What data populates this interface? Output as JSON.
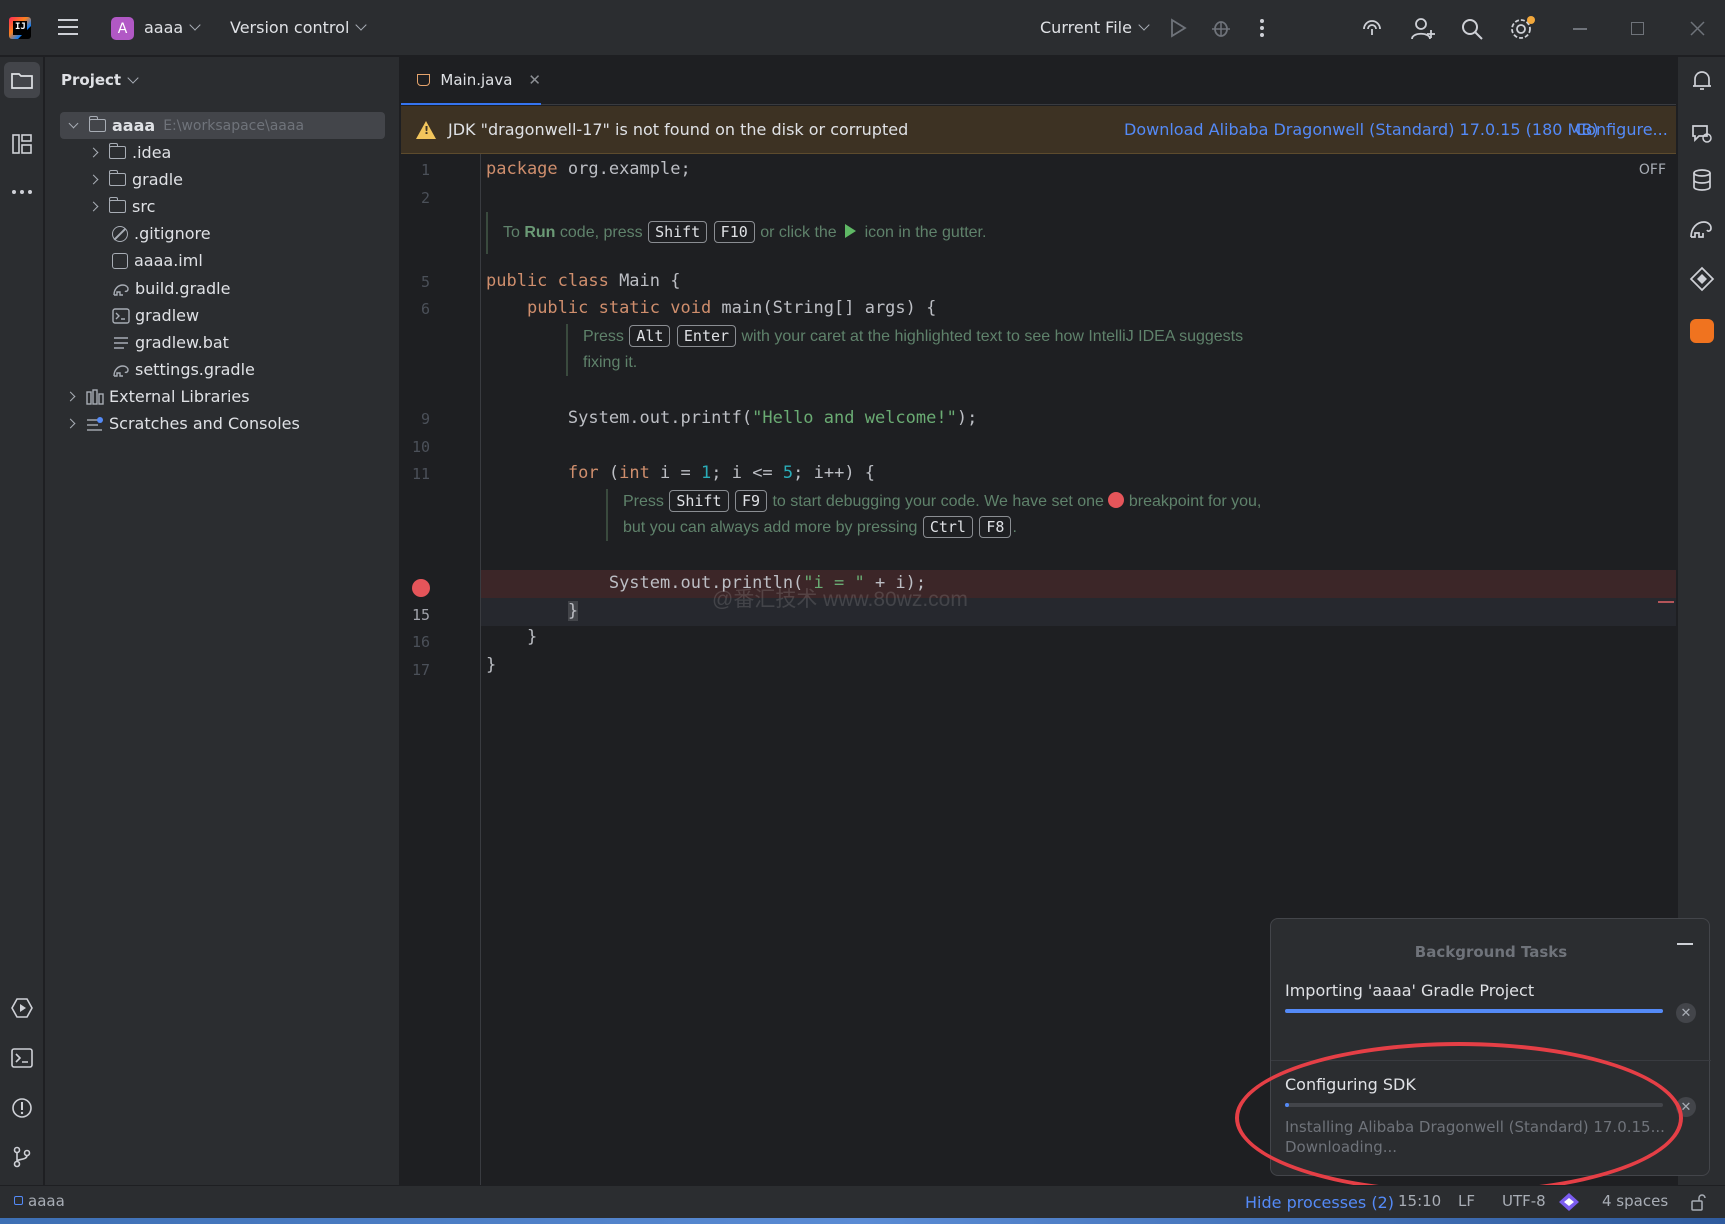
{
  "titlebar": {
    "logo_text": "IJ",
    "project_initial": "A",
    "project_name": "aaaa",
    "vcs_label": "Version control",
    "run_config": "Current File"
  },
  "project_panel": {
    "title": "Project",
    "root_name": "aaaa",
    "root_path": "E:\\worksapace\\aaaa",
    "items": [
      {
        "label": ".idea",
        "icon": "folder-icon"
      },
      {
        "label": "gradle",
        "icon": "folder-icon"
      },
      {
        "label": "src",
        "icon": "folder-icon"
      },
      {
        "label": ".gitignore",
        "icon": "ignore-file-icon"
      },
      {
        "label": "aaaa.iml",
        "icon": "module-file-icon"
      },
      {
        "label": "build.gradle",
        "icon": "gradle-file-icon"
      },
      {
        "label": "gradlew",
        "icon": "script-file-icon"
      },
      {
        "label": "gradlew.bat",
        "icon": "text-file-icon"
      },
      {
        "label": "settings.gradle",
        "icon": "gradle-file-icon"
      }
    ],
    "external_libraries": "External Libraries",
    "scratches": "Scratches and Consoles"
  },
  "editor": {
    "tab_label": "Main.java",
    "jdk_warning": "JDK \"dragonwell-17\" is not found on the disk or corrupted",
    "download_link": "Download Alibaba Dragonwell (Standard) 17.0.15 (180 MB)",
    "configure_link": "Configure...",
    "off_label": "OFF",
    "line_numbers": [
      "1",
      "2",
      "5",
      "6",
      "9",
      "10",
      "11",
      "15",
      "16",
      "17"
    ],
    "code": {
      "l1_kw": "package",
      "l1_rest": " org.example;",
      "l5_kw": "public class",
      "l5_rest": " Main {",
      "l6_kw": "public static void",
      "l6_rest": " main(String[] args) {",
      "l9_a": "System.out.printf(",
      "l9_str": "\"Hello and welcome!\"",
      "l9_b": ");",
      "l11_kw1": "for",
      "l11_a": " (",
      "l11_kw2": "int",
      "l11_b": " i = ",
      "l11_n1": "1",
      "l11_c": "; i <= ",
      "l11_n2": "5",
      "l11_d": "; i++) {",
      "l14_a": "System.out.println(",
      "l14_str": "\"i = \"",
      "l14_b": " + i);",
      "l15": "}",
      "l16": "}",
      "l17": "}"
    },
    "hint1": {
      "a": "To ",
      "b": "Run",
      "c": " code, press ",
      "k1": "Shift",
      "k2": "F10",
      "d": " or click the ",
      "e": " icon in the gutter."
    },
    "hint2": {
      "a": "Press ",
      "k1": "Alt",
      "k2": "Enter",
      "b": " with your caret at the highlighted text to see how IntelliJ IDEA suggests",
      "c": "fixing it."
    },
    "hint3": {
      "a": "Press ",
      "k1": "Shift",
      "k2": "F9",
      "b": " to start debugging your code. We have set one ",
      "c": " breakpoint for you,",
      "d": "but you can always add more by pressing ",
      "k3": "Ctrl",
      "k4": "F8",
      "e": "."
    },
    "watermark": "@番汇技术  www.80wz.com"
  },
  "bg_tasks": {
    "title": "Background Tasks",
    "task1_name": "Importing 'aaaa' Gradle Project",
    "task1_progress": 1.0,
    "task2_name": "Configuring SDK",
    "task2_progress": 0.01,
    "task2_detail1": "Installing Alibaba Dragonwell (Standard) 17.0.15...",
    "task2_detail2": "Downloading..."
  },
  "statusbar": {
    "project": "aaaa",
    "hide_processes": "Hide processes (2)",
    "position": "15:10",
    "line_sep": "LF",
    "encoding": "UTF-8",
    "indent": "4 spaces"
  },
  "colors": {
    "accent": "#3574f0",
    "link": "#548af7",
    "breakpoint": "#e5555a",
    "annotation": "#e53f46"
  }
}
